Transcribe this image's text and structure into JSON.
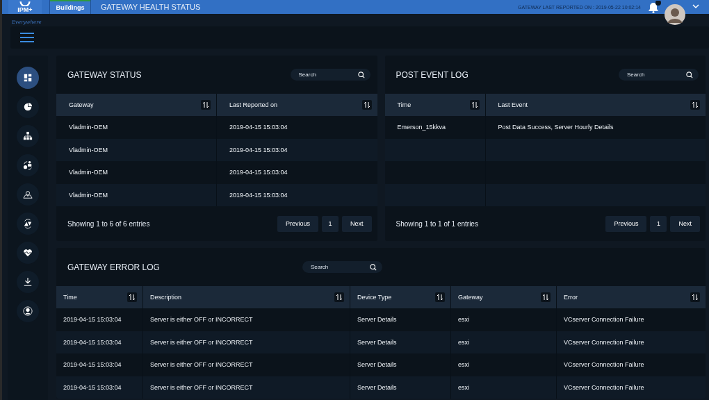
{
  "header": {
    "logo": "IPM+",
    "tagline": "Everywhere",
    "tabs": [
      {
        "label": "Buildings",
        "selected": true
      }
    ],
    "title": "GATEWAY HEALTH STATUS",
    "last_reported": "GATEWAY LAST REPORTED ON : 2019-05-22 10:02:14"
  },
  "sidebar": {
    "items": [
      {
        "selected": true
      },
      {
        "selected": false
      },
      {
        "selected": false
      },
      {
        "selected": false
      },
      {
        "selected": false
      },
      {
        "selected": false
      },
      {
        "selected": false
      },
      {
        "selected": false
      },
      {
        "selected": false
      }
    ]
  },
  "gateway_status": {
    "title": "GATEWAY STATUS",
    "search": {
      "placeholder": "Search"
    },
    "columns": [
      "Gateway",
      "Last Reported on"
    ],
    "rows": [
      [
        "Vladmin-OEM",
        "2019-04-15  15:03:04"
      ],
      [
        "Vladmin-OEM",
        "2019-04-15  15:03:04"
      ],
      [
        "Vladmin-OEM",
        "2019-04-15  15:03:04"
      ],
      [
        "Vladmin-OEM",
        "2019-04-15  15:03:04"
      ]
    ],
    "info": "Showing 1 to 6 of 6 entries",
    "pagination": [
      "Previous",
      "1",
      "Next"
    ]
  },
  "post_event_log": {
    "title": "POST EVENT LOG",
    "search": {
      "placeholder": "Search"
    },
    "columns": [
      "Time",
      "Last Event"
    ],
    "rows": [
      [
        "Emerson_15kkva",
        "Post Data Success, Server Hourly Details"
      ]
    ],
    "info": "Showing 1 to 1 of 1 entries",
    "pagination": [
      "Previous",
      "1",
      "Next"
    ]
  },
  "gateway_error_log": {
    "title": "GATEWAY ERROR LOG",
    "search": {
      "placeholder": "Search"
    },
    "columns": [
      "Time",
      "Description",
      "Device Type",
      "Gateway",
      "Error"
    ],
    "rows": [
      [
        "2019-04-15  15:03:04",
        "Server is either OFF or INCORRECT",
        "Server Details",
        "esxi",
        "VCserver Connection Failure"
      ],
      [
        "2019-04-15  15:03:04",
        "Server is either OFF or INCORRECT",
        "Server Details",
        "esxi",
        "VCserver Connection Failure"
      ],
      [
        "2019-04-15  15:03:04",
        "Server is either OFF or INCORRECT",
        "Server Details",
        "esxi",
        "VCserver Connection Failure"
      ],
      [
        "2019-04-15  15:03:04",
        "Server is either OFF or INCORRECT",
        "Server Details",
        "esxi",
        "VCserver Connection Failure"
      ]
    ]
  }
}
